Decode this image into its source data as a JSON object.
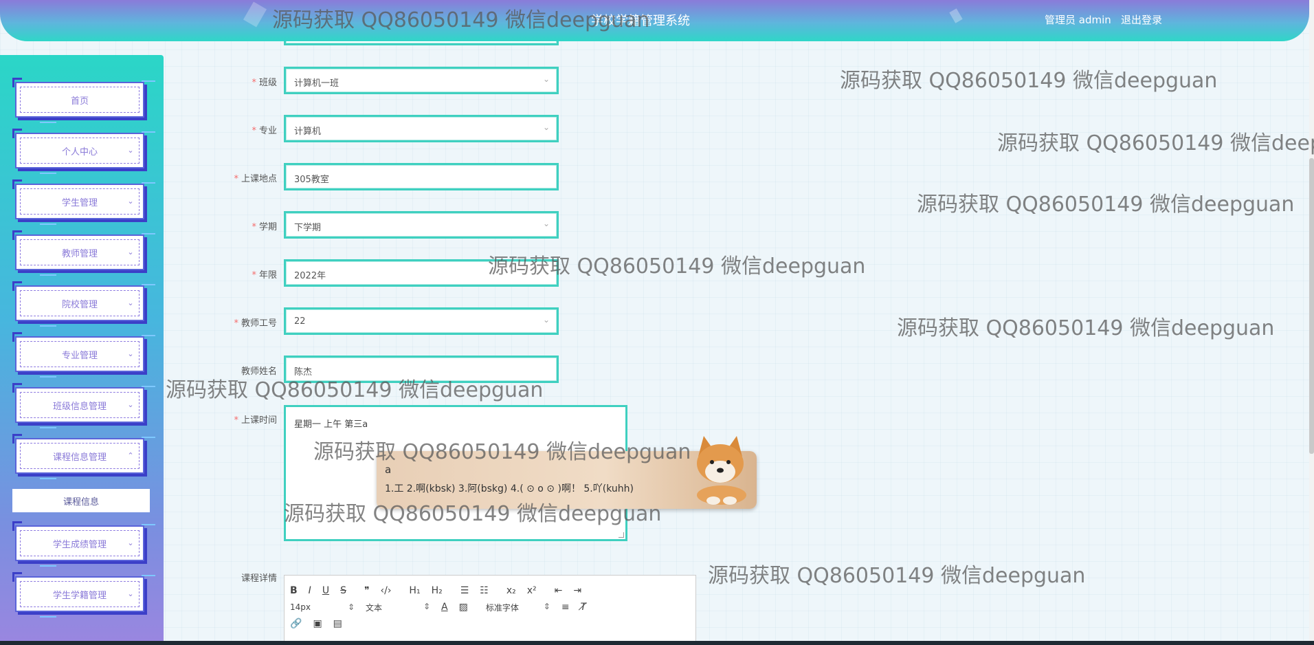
{
  "header": {
    "title": "学校学籍管理系统",
    "user_text": "管理员 admin",
    "logout_label": "退出登录"
  },
  "sidebar": {
    "items": [
      {
        "label": "首页",
        "has_chevron": false
      },
      {
        "label": "个人中心",
        "has_chevron": true
      },
      {
        "label": "学生管理",
        "has_chevron": true
      },
      {
        "label": "教师管理",
        "has_chevron": true
      },
      {
        "label": "院校管理",
        "has_chevron": true
      },
      {
        "label": "专业管理",
        "has_chevron": true
      },
      {
        "label": "班级信息管理",
        "has_chevron": true
      },
      {
        "label": "课程信息管理",
        "has_chevron": true,
        "expanded": true
      },
      {
        "label": "学生成绩管理",
        "has_chevron": true
      },
      {
        "label": "学生学籍管理",
        "has_chevron": true
      }
    ],
    "submenu_active": "课程信息"
  },
  "form": {
    "class_label": "班级",
    "class_value": "计算机一班",
    "major_label": "专业",
    "major_value": "计算机",
    "location_label": "上课地点",
    "location_value": "305教室",
    "term_label": "学期",
    "term_value": "下学期",
    "year_label": "年限",
    "year_value": "2022年",
    "teacher_id_label": "教师工号",
    "teacher_id_value": "22",
    "teacher_name_label": "教师姓名",
    "teacher_name_value": "陈杰",
    "time_label": "上课时间",
    "time_value": "星期一 上午 第三a",
    "detail_label": "课程详情"
  },
  "editor": {
    "font_size": "14px",
    "block_type": "文本",
    "font_family": "标准字体"
  },
  "ime": {
    "input": "a",
    "candidates": "1.工  2.啊(kbsk)  3.阿(bskg)  4.( ⊙ o ⊙ )啊！  5.吖(kuhh)"
  },
  "watermark": "源码获取 QQ86050149 微信deepguan",
  "colors": {
    "accent_teal": "#3fd0c0",
    "header_purple": "#8a7bd9",
    "menu_border": "#5a63d9",
    "required": "#f56c6c"
  }
}
